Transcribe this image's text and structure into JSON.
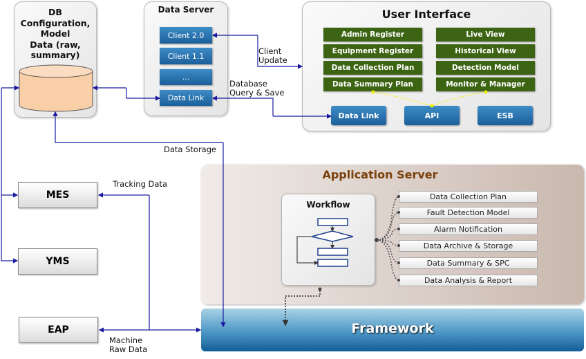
{
  "db": {
    "title_lines": [
      "DB",
      "Configuration,",
      "Model",
      "Data (raw,",
      "summary)"
    ]
  },
  "data_server": {
    "title": "Data Server",
    "items": [
      "Client 2.0",
      "Client 1.1",
      "...",
      "Data Link"
    ]
  },
  "user_interface": {
    "title": "User Interface",
    "left_items": [
      "Admin Register",
      "Equipment Register",
      "Data Collection Plan",
      "Data Summary Plan"
    ],
    "right_items": [
      "Live View",
      "Historical View",
      "Detection Model",
      "Monitor & Manager"
    ],
    "bottom_items": [
      "Data Link",
      "API",
      "ESB"
    ]
  },
  "labels": {
    "client_update": [
      "Client",
      "Update"
    ],
    "db_query": [
      "Database",
      "Query & Save"
    ],
    "data_storage": "Data Storage",
    "tracking_data": "Tracking Data",
    "machine_raw": [
      "Machine",
      "Raw Data"
    ]
  },
  "systems": [
    "MES",
    "YMS",
    "EAP"
  ],
  "app_server": {
    "title": "Application Server",
    "workflow_title": "Workflow",
    "items": [
      "Data Collection Plan",
      "Fault Detection Model",
      "Alarm Notification",
      "Data Archive & Storage",
      "Data Summary & SPC",
      "Data Analysis & Report"
    ]
  },
  "framework": {
    "title": "Framework"
  },
  "colors": {
    "connector": "#1a1aa0",
    "ui_green": "#3c6412",
    "app_title": "#7a3f0a",
    "button_blue": "#2a70b0"
  }
}
